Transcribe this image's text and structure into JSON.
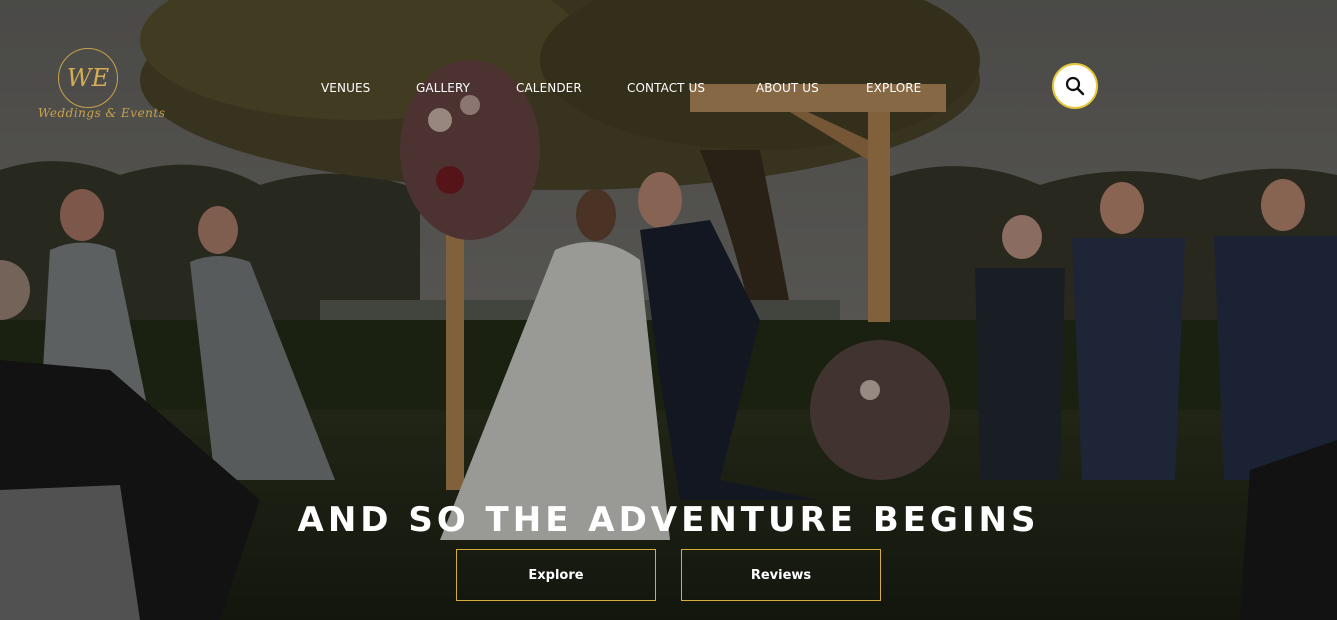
{
  "brand": {
    "monogram": "WE",
    "script_text": "Weddings & Events",
    "accent_color": "#c8a24a"
  },
  "nav": {
    "items": [
      {
        "label": "VENUES"
      },
      {
        "label": "GALLERY"
      },
      {
        "label": "CALENDER"
      },
      {
        "label": "CONTACT US"
      },
      {
        "label": "ABOUT US"
      },
      {
        "label": "EXPLORE"
      }
    ],
    "search_icon": "search-icon"
  },
  "hero": {
    "image_subject": "wedding-ceremony-photo",
    "headline": "AND SO THE ADVENTURE BEGINS",
    "buttons": {
      "explore": "Explore",
      "reviews": "Reviews"
    },
    "button_border_color": "#d4ad3a"
  }
}
